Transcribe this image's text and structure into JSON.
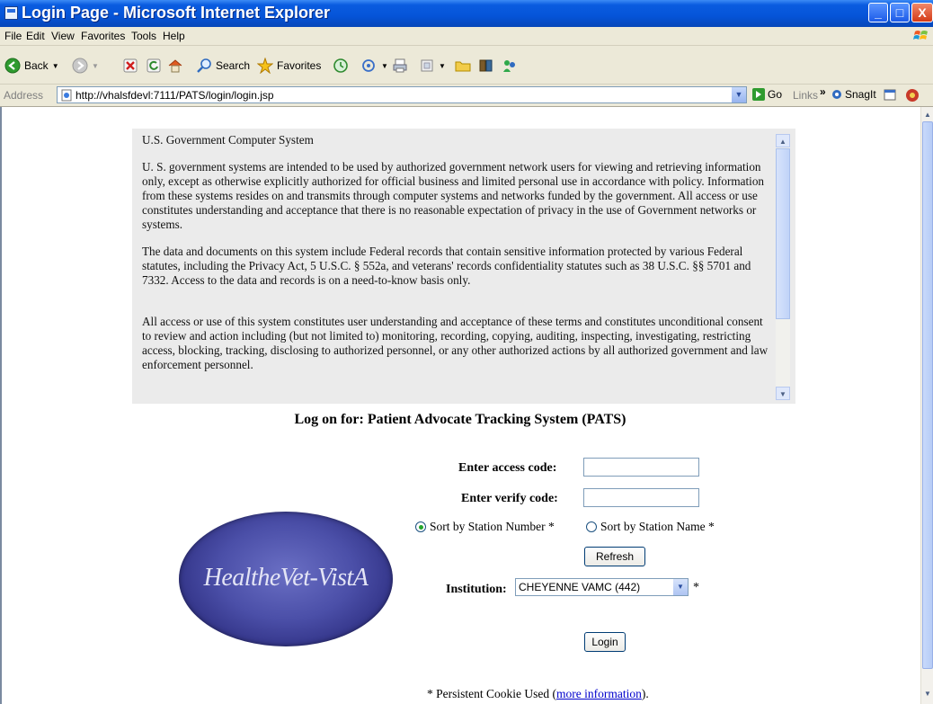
{
  "window": {
    "title": "Login Page - Microsoft Internet Explorer",
    "min": "_",
    "max": "□",
    "close": "X"
  },
  "menu": [
    "File",
    "Edit",
    "View",
    "Favorites",
    "Tools",
    "Help"
  ],
  "toolbar": {
    "back": "Back",
    "search": "Search",
    "favorites": "Favorites"
  },
  "address": {
    "label": "Address",
    "url": "http://vhalsfdevl:7111/PATS/login/login.jsp",
    "go": "Go",
    "links": "Links",
    "snagit": "SnagIt"
  },
  "notice": {
    "heading": "U.S. Government Computer System",
    "paragraphs": [
      "U. S. government systems are intended to be used by authorized government network users for viewing and retrieving information only, except as otherwise explicitly authorized for official business and limited personal use in accordance with policy. Information from these systems resides on and transmits through computer systems and networks funded by the government. All access or use constitutes understanding and acceptance that there is no reasonable expectation of privacy in the use of Government networks or systems.",
      "The data and documents on this system include Federal records that contain sensitive information protected by various Federal statutes, including the Privacy Act, 5 U.S.C. § 552a, and veterans' records confidentiality statutes such as 38 U.S.C. §§ 5701 and 7332. Access to the data and records is on a need-to-know basis only.",
      "All access or use of this system constitutes user understanding and acceptance of these terms and constitutes unconditional consent to review and action including (but not limited to) monitoring, recording, copying, auditing, inspecting, investigating, restricting access, blocking, tracking, disclosing to authorized personnel, or any other authorized actions by all authorized government and law enforcement personnel."
    ]
  },
  "login": {
    "heading": "Log on for: Patient Advocate Tracking System (PATS)",
    "access_label": "Enter access code:",
    "verify_label": "Enter verify code:",
    "access_value": "",
    "verify_value": "",
    "sort_number": "Sort by Station Number *",
    "sort_name": "Sort by Station Name *",
    "refresh": "Refresh",
    "institution_label": "Institution:",
    "institution_value": "CHEYENNE VAMC (442)",
    "required_mark": "*",
    "login_button": "Login"
  },
  "logo": {
    "text": "HealtheVet-VistA"
  },
  "footer": {
    "prefix": "* Persistent Cookie Used (",
    "link": "more information",
    "suffix": ")."
  }
}
